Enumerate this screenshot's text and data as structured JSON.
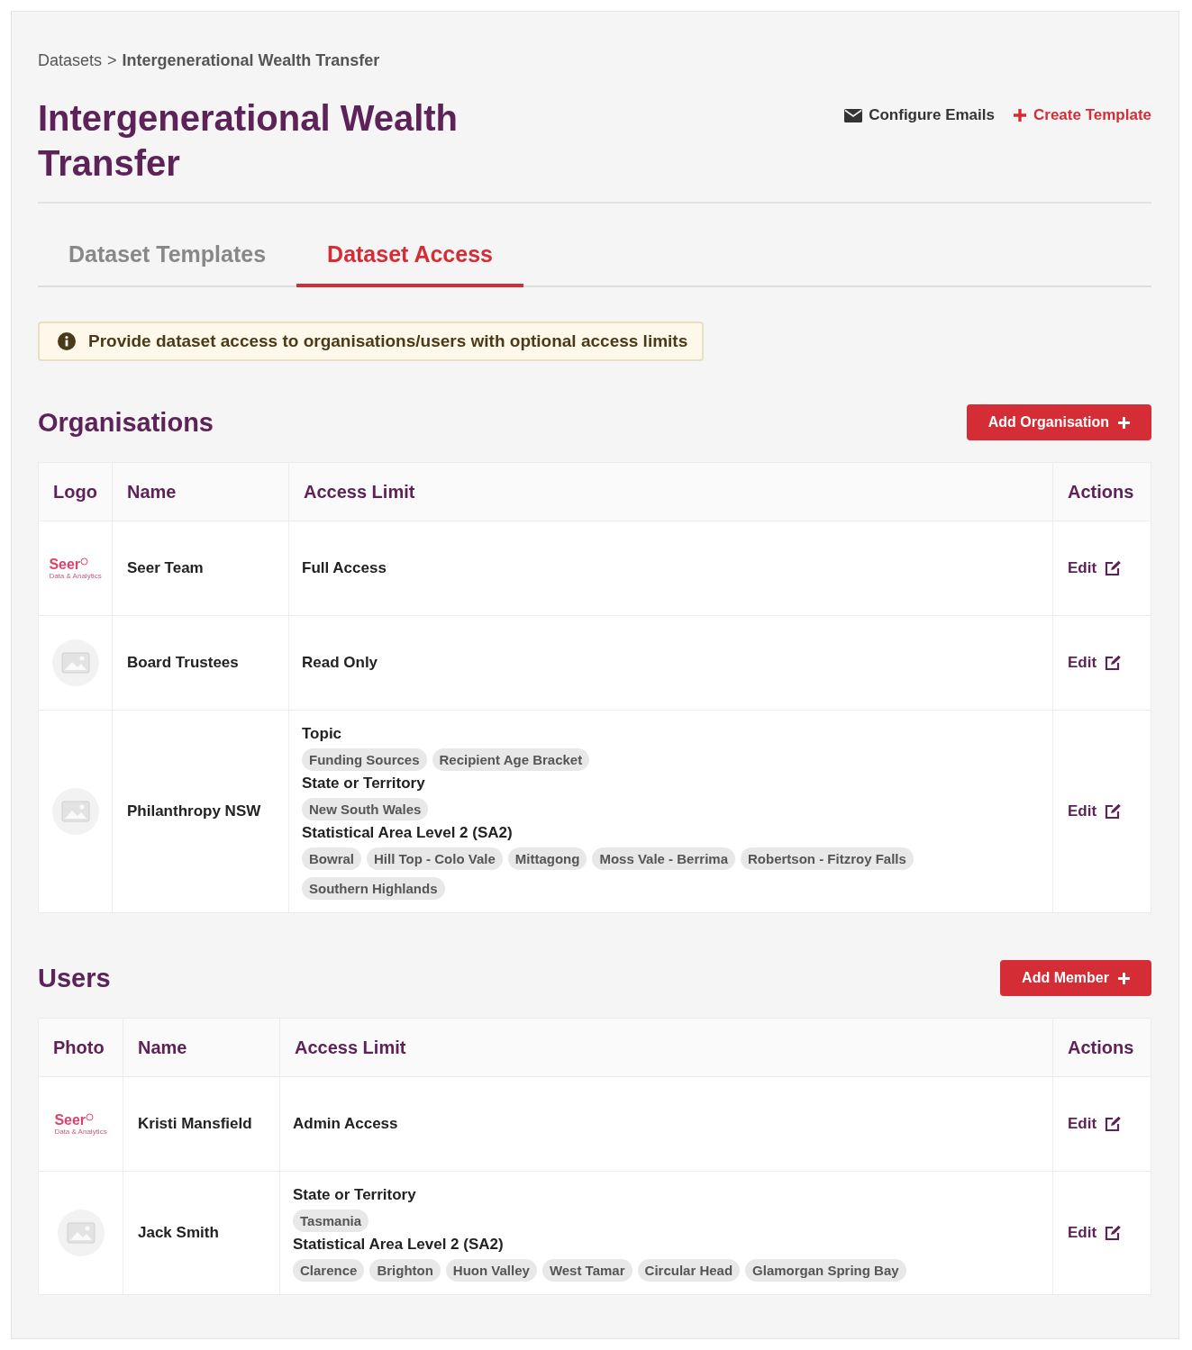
{
  "breadcrumb": {
    "parent": "Datasets",
    "separator": ">",
    "current": "Intergenerational Wealth Transfer"
  },
  "title": "Intergenerational Wealth Transfer",
  "header_actions": [
    {
      "kind": "email",
      "label": "Configure Emails"
    },
    {
      "kind": "create",
      "label": "Create Template"
    }
  ],
  "tabs": [
    {
      "label": "Dataset Templates",
      "selected": false
    },
    {
      "label": "Dataset Access",
      "selected": true
    }
  ],
  "info_banner": "Provide dataset access to organisations/users with optional access limits",
  "sections": [
    {
      "title": "Organisations",
      "button": "Add Organisation",
      "columns": [
        "Logo",
        "Name",
        "Access Limit",
        "Actions"
      ],
      "rows": [
        {
          "image": {
            "kind": "logo",
            "text": "Seer",
            "subtext": "Data & Analytics"
          },
          "name": "Seer Team",
          "access": "Full Access",
          "action": "Edit"
        },
        {
          "image": {
            "kind": "placeholder"
          },
          "name": "Board Trustees",
          "access": "Read Only",
          "action": "Edit"
        },
        {
          "image": {
            "kind": "placeholder"
          },
          "name": "Philanthropy NSW",
          "groups": [
            {
              "label": "Topic",
              "tags": [
                "Funding Sources",
                "Recipient Age Bracket"
              ]
            },
            {
              "label": "State or Territory",
              "tags": [
                "New South Wales"
              ]
            },
            {
              "label": "Statistical Area Level 2 (SA2)",
              "tags": [
                "Bowral",
                "Hill Top - Colo Vale",
                "Mittagong",
                "Moss Vale - Berrima",
                "Robertson - Fitzroy Falls",
                "Southern Highlands"
              ]
            }
          ],
          "action": "Edit"
        }
      ]
    },
    {
      "title": "Users",
      "button": "Add Member",
      "columns": [
        "Photo",
        "Name",
        "Access Limit",
        "Actions"
      ],
      "rows": [
        {
          "image": {
            "kind": "logo",
            "text": "Seer",
            "subtext": "Data & Analytics"
          },
          "name": "Kristi Mansfield",
          "access": "Admin Access",
          "action": "Edit"
        },
        {
          "image": {
            "kind": "placeholder"
          },
          "name": "Jack Smith",
          "groups": [
            {
              "label": "State or Territory",
              "tags": [
                "Tasmania"
              ]
            },
            {
              "label": "Statistical Area Level 2 (SA2)",
              "tags": [
                "Clarence",
                "Brighton",
                "Huon Valley",
                "West Tamar",
                "Circular Head",
                "Glamorgan Spring Bay"
              ]
            }
          ],
          "action": "Edit"
        }
      ]
    }
  ]
}
